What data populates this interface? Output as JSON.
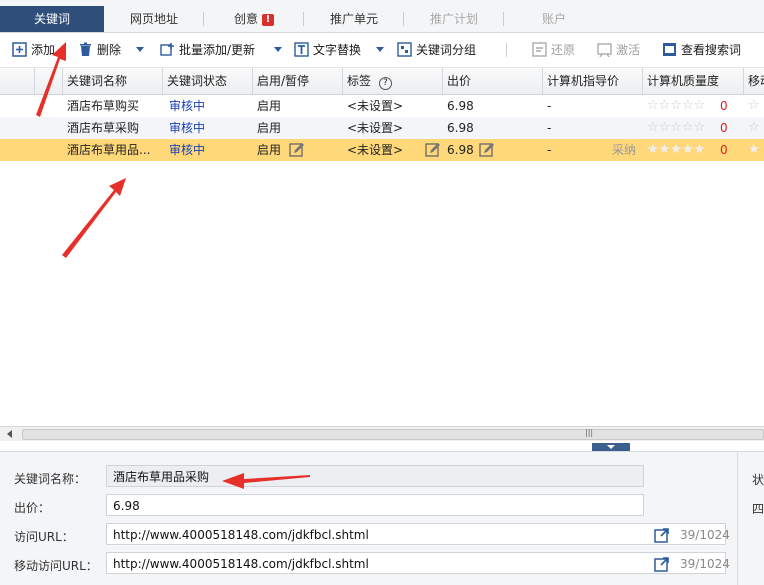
{
  "tabs": [
    {
      "label": "关键词",
      "active": true
    },
    {
      "label": "网页地址"
    },
    {
      "label": "创意",
      "badge": "!"
    },
    {
      "label": "推广单元"
    },
    {
      "label": "推广计划",
      "disabled": true
    },
    {
      "label": "账户",
      "disabled": true
    }
  ],
  "toolbar": {
    "add": "添加",
    "delete": "删除",
    "batch": "批量添加/更新",
    "replace": "文字替换",
    "group": "关键词分组",
    "restore": "还原",
    "activate": "激活",
    "view": "查看搜索词"
  },
  "columns": {
    "name": "关键词名称",
    "status": "关键词状态",
    "enable": "启用/暂停",
    "tag": "标签",
    "bid": "出价",
    "pc_price": "计算机指导价",
    "pc_quality": "计算机质量度",
    "mobile": "移动"
  },
  "rows": [
    {
      "name": "酒店布草购买",
      "status": "审核中",
      "enable": "启用",
      "tag": "<未设置>",
      "bid": "6.98",
      "pc_price": "-",
      "quality": "0",
      "note": ""
    },
    {
      "name": "酒店布草采购",
      "status": "审核中",
      "enable": "启用",
      "tag": "<未设置>",
      "bid": "6.98",
      "pc_price": "-",
      "quality": "0",
      "note": ""
    },
    {
      "name": "酒店布草用品...",
      "status": "审核中",
      "enable": "启用",
      "tag": "<未设置>",
      "bid": "6.98",
      "pc_price": "-",
      "quality": "0",
      "note": "采纳"
    }
  ],
  "form": {
    "name_label": "关键词名称：",
    "name_value": "酒店布草用品采购",
    "bid_label": "出价：",
    "bid_value": "6.98",
    "url_label": "访问URL：",
    "url_value": "http://www.4000518148.com/jdkfbcl.shtml",
    "url_count": "39/1024",
    "murl_label": "移动访问URL：",
    "murl_value": "http://www.4000518148.com/jdkfbcl.shtml",
    "murl_count": "39/1024",
    "right_label1": "状",
    "right_label2": "四"
  },
  "scroll_grip": "|||",
  "colors": {
    "accent": "#2f4f7a",
    "selected": "#ffd87a",
    "status": "#1a3fb0",
    "arrow": "#e8302a"
  }
}
